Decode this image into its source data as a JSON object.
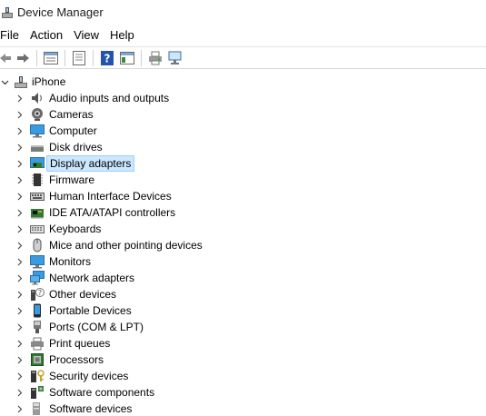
{
  "window": {
    "title": "Device Manager"
  },
  "menu": [
    "File",
    "Action",
    "View",
    "Help"
  ],
  "toolbar": {
    "buttons": [
      "back-arrow-icon",
      "forward-arrow-icon",
      "properties-icon",
      "update-list-icon",
      "help-icon",
      "show-hide-pane-icon",
      "print-icon",
      "scan-hardware-icon"
    ]
  },
  "tree": {
    "root": {
      "label": "iPhone",
      "expanded": true
    },
    "items": [
      {
        "label": "Audio inputs and outputs",
        "icon": "speaker-icon"
      },
      {
        "label": "Cameras",
        "icon": "camera-icon"
      },
      {
        "label": "Computer",
        "icon": "computer-icon"
      },
      {
        "label": "Disk drives",
        "icon": "disk-drive-icon"
      },
      {
        "label": "Display adapters",
        "icon": "display-adapter-icon",
        "selected": true
      },
      {
        "label": "Firmware",
        "icon": "firmware-icon"
      },
      {
        "label": "Human Interface Devices",
        "icon": "hid-icon"
      },
      {
        "label": "IDE ATA/ATAPI controllers",
        "icon": "ide-controller-icon"
      },
      {
        "label": "Keyboards",
        "icon": "keyboard-icon"
      },
      {
        "label": "Mice and other pointing devices",
        "icon": "mouse-icon"
      },
      {
        "label": "Monitors",
        "icon": "monitor-icon"
      },
      {
        "label": "Network adapters",
        "icon": "network-adapter-icon"
      },
      {
        "label": "Other devices",
        "icon": "other-devices-icon"
      },
      {
        "label": "Portable Devices",
        "icon": "portable-device-icon"
      },
      {
        "label": "Ports (COM & LPT)",
        "icon": "port-icon"
      },
      {
        "label": "Print queues",
        "icon": "printer-icon"
      },
      {
        "label": "Processors",
        "icon": "processor-icon"
      },
      {
        "label": "Security devices",
        "icon": "security-device-icon"
      },
      {
        "label": "Software components",
        "icon": "software-component-icon"
      },
      {
        "label": "Software devices",
        "icon": "software-device-icon"
      }
    ]
  },
  "colors": {
    "selection_bg": "#cce8ff",
    "selection_border": "#99d1ff",
    "accent": "#1e78c8"
  }
}
